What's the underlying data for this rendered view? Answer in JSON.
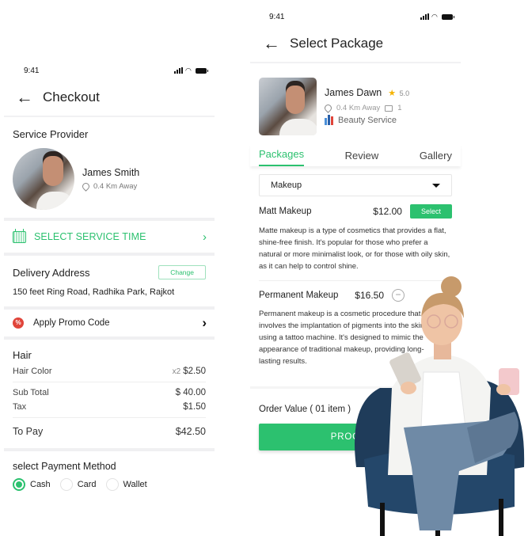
{
  "checkout": {
    "status_time": "9:41",
    "title": "Checkout",
    "service_provider_label": "Service Provider",
    "provider": {
      "name": "James Smith",
      "distance": "0.4 Km Away"
    },
    "service_time_label": "SELECT SERVICE TIME",
    "delivery": {
      "title": "Delivery Address",
      "change_label": "Change",
      "address": "150 feet Ring Road, Radhika Park, Rajkot"
    },
    "promo": {
      "badge": "%",
      "label": "Apply Promo Code"
    },
    "bill": {
      "category": "Hair",
      "items": [
        {
          "name": "Hair Color",
          "qty": "x2",
          "price": "$2.50"
        }
      ],
      "sub_total_label": "Sub Total",
      "sub_total": "$ 40.00",
      "tax_label": "Tax",
      "tax": "$1.50",
      "to_pay_label": "To Pay",
      "to_pay": "$42.50"
    },
    "payment": {
      "title": "select Payment Method",
      "options": [
        {
          "label": "Cash",
          "selected": true
        },
        {
          "label": "Card",
          "selected": false
        },
        {
          "label": "Wallet",
          "selected": false
        }
      ]
    }
  },
  "select_package": {
    "status_time": "9:41",
    "title": "Select Package",
    "provider": {
      "name": "James Dawn",
      "rating": "5.0",
      "distance": "0.4 Km Away",
      "jobs": "1",
      "service": "Beauty Service"
    },
    "tabs": [
      {
        "label": "Packages",
        "active": true
      },
      {
        "label": "Review",
        "active": false
      },
      {
        "label": "Gallery",
        "active": false
      }
    ],
    "category_dropdown": "Makeup",
    "packages": [
      {
        "title": "Matt Makeup",
        "price": "$12.00",
        "action": "Select",
        "description": "Matte makeup is a type of cosmetics that provides a flat, shine-free finish. It's popular for those who prefer a natural or more minimalist look, or for those with oily skin, as it can help to control shine."
      },
      {
        "title": "Permanent Makeup",
        "price": "$16.50",
        "action": "−",
        "description": "Permanent makeup is a cosmetic procedure that involves the implantation of pigments into the skin using a tattoo machine. It's designed to mimic the appearance of traditional makeup, providing long-lasting results."
      }
    ],
    "order_value": "Order Value ( 01 item )",
    "proceed_label": "PROCEED"
  },
  "colors": {
    "accent": "#2cc16f",
    "promo": "#e0453a",
    "star": "#f5b301"
  }
}
